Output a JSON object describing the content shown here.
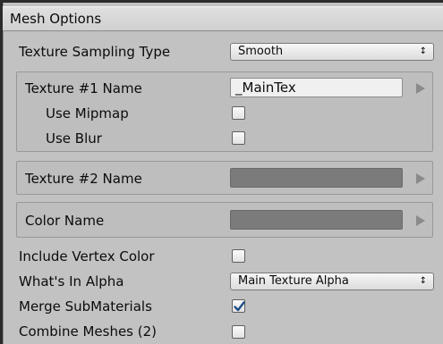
{
  "header": {
    "title": "Mesh Options"
  },
  "texture_sampling": {
    "label": "Texture Sampling Type",
    "value": "Smooth"
  },
  "texture1": {
    "label": "Texture #1 Name",
    "value": "_MainTex",
    "use_mipmap": {
      "label": "Use Mipmap",
      "checked": false
    },
    "use_blur": {
      "label": "Use Blur",
      "checked": false
    }
  },
  "texture2": {
    "label": "Texture #2 Name",
    "value": ""
  },
  "color_name": {
    "label": "Color Name",
    "value": ""
  },
  "include_vertex_color": {
    "label": "Include Vertex Color",
    "checked": false
  },
  "whats_in_alpha": {
    "label": "What's In Alpha",
    "value": "Main Texture Alpha"
  },
  "merge_submaterials": {
    "label": "Merge SubMaterials",
    "checked": true
  },
  "combine_meshes": {
    "label": "Combine Meshes (2)",
    "checked": false
  },
  "icons": {
    "dropdown": "up-down-arrows-icon",
    "expand": "right-triangle-icon",
    "check": "checkmark-icon"
  },
  "colors": {
    "checkmark": "#1e4f86",
    "panel_bg": "#c2c2c2",
    "window_bg": "#2b2b2b"
  }
}
